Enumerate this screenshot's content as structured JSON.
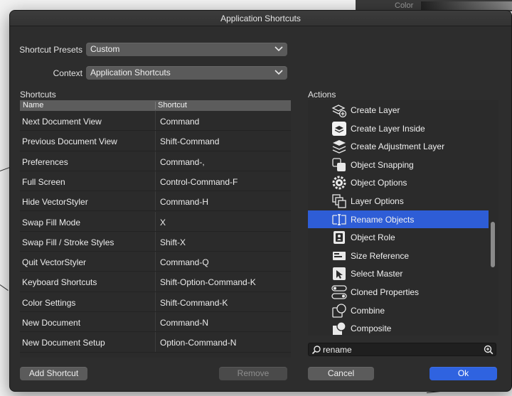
{
  "background": {
    "color_label": "Color"
  },
  "window": {
    "title": "Application Shortcuts"
  },
  "presets": {
    "label": "Shortcut Presets",
    "value": "Custom"
  },
  "context": {
    "label": "Context",
    "value": "Application Shortcuts"
  },
  "shortcuts": {
    "section_label": "Shortcuts",
    "columns": {
      "name": "Name",
      "shortcut": "Shortcut"
    },
    "rows": [
      {
        "name": "Next Document View",
        "shortcut": "Command"
      },
      {
        "name": "Previous Document View",
        "shortcut": "Shift-Command"
      },
      {
        "name": "Preferences",
        "shortcut": "Command-,"
      },
      {
        "name": "Full Screen",
        "shortcut": "Control-Command-F"
      },
      {
        "name": "Hide VectorStyler",
        "shortcut": "Command-H"
      },
      {
        "name": "Swap Fill Mode",
        "shortcut": "X"
      },
      {
        "name": "Swap Fill / Stroke Styles",
        "shortcut": "Shift-X"
      },
      {
        "name": "Quit VectorStyler",
        "shortcut": "Command-Q"
      },
      {
        "name": "Keyboard Shortcuts",
        "shortcut": "Shift-Option-Command-K"
      },
      {
        "name": "Color Settings",
        "shortcut": "Shift-Command-K"
      },
      {
        "name": "New Document",
        "shortcut": "Command-N"
      },
      {
        "name": "New Document Setup",
        "shortcut": "Option-Command-N"
      }
    ]
  },
  "actions": {
    "section_label": "Actions",
    "items": [
      {
        "label": "Create Layer",
        "icon": "create-layer-icon",
        "selected": false
      },
      {
        "label": "Create Layer Inside",
        "icon": "create-layer-inside-icon",
        "selected": false
      },
      {
        "label": "Create Adjustment Layer",
        "icon": "adjustment-layer-icon",
        "selected": false
      },
      {
        "label": "Object Snapping",
        "icon": "object-snapping-icon",
        "selected": false
      },
      {
        "label": "Object Options",
        "icon": "gear-icon",
        "selected": false
      },
      {
        "label": "Layer Options",
        "icon": "layer-options-icon",
        "selected": false
      },
      {
        "label": "Rename Objects",
        "icon": "rename-icon",
        "selected": true
      },
      {
        "label": "Object Role",
        "icon": "object-role-icon",
        "selected": false
      },
      {
        "label": "Size Reference",
        "icon": "size-reference-icon",
        "selected": false
      },
      {
        "label": "Select Master",
        "icon": "select-master-icon",
        "selected": false
      },
      {
        "label": "Cloned Properties",
        "icon": "cloned-properties-icon",
        "selected": false
      },
      {
        "label": "Combine",
        "icon": "combine-icon",
        "selected": false
      },
      {
        "label": "Composite",
        "icon": "composite-icon",
        "selected": false
      }
    ]
  },
  "search": {
    "value": "rename",
    "placeholder": ""
  },
  "buttons": {
    "add_shortcut": "Add Shortcut",
    "remove": "Remove",
    "cancel": "Cancel",
    "ok": "Ok"
  },
  "colors": {
    "accent": "#2e5dd6",
    "panel": "#2d2d2d",
    "selection": "#2e5dd6"
  }
}
